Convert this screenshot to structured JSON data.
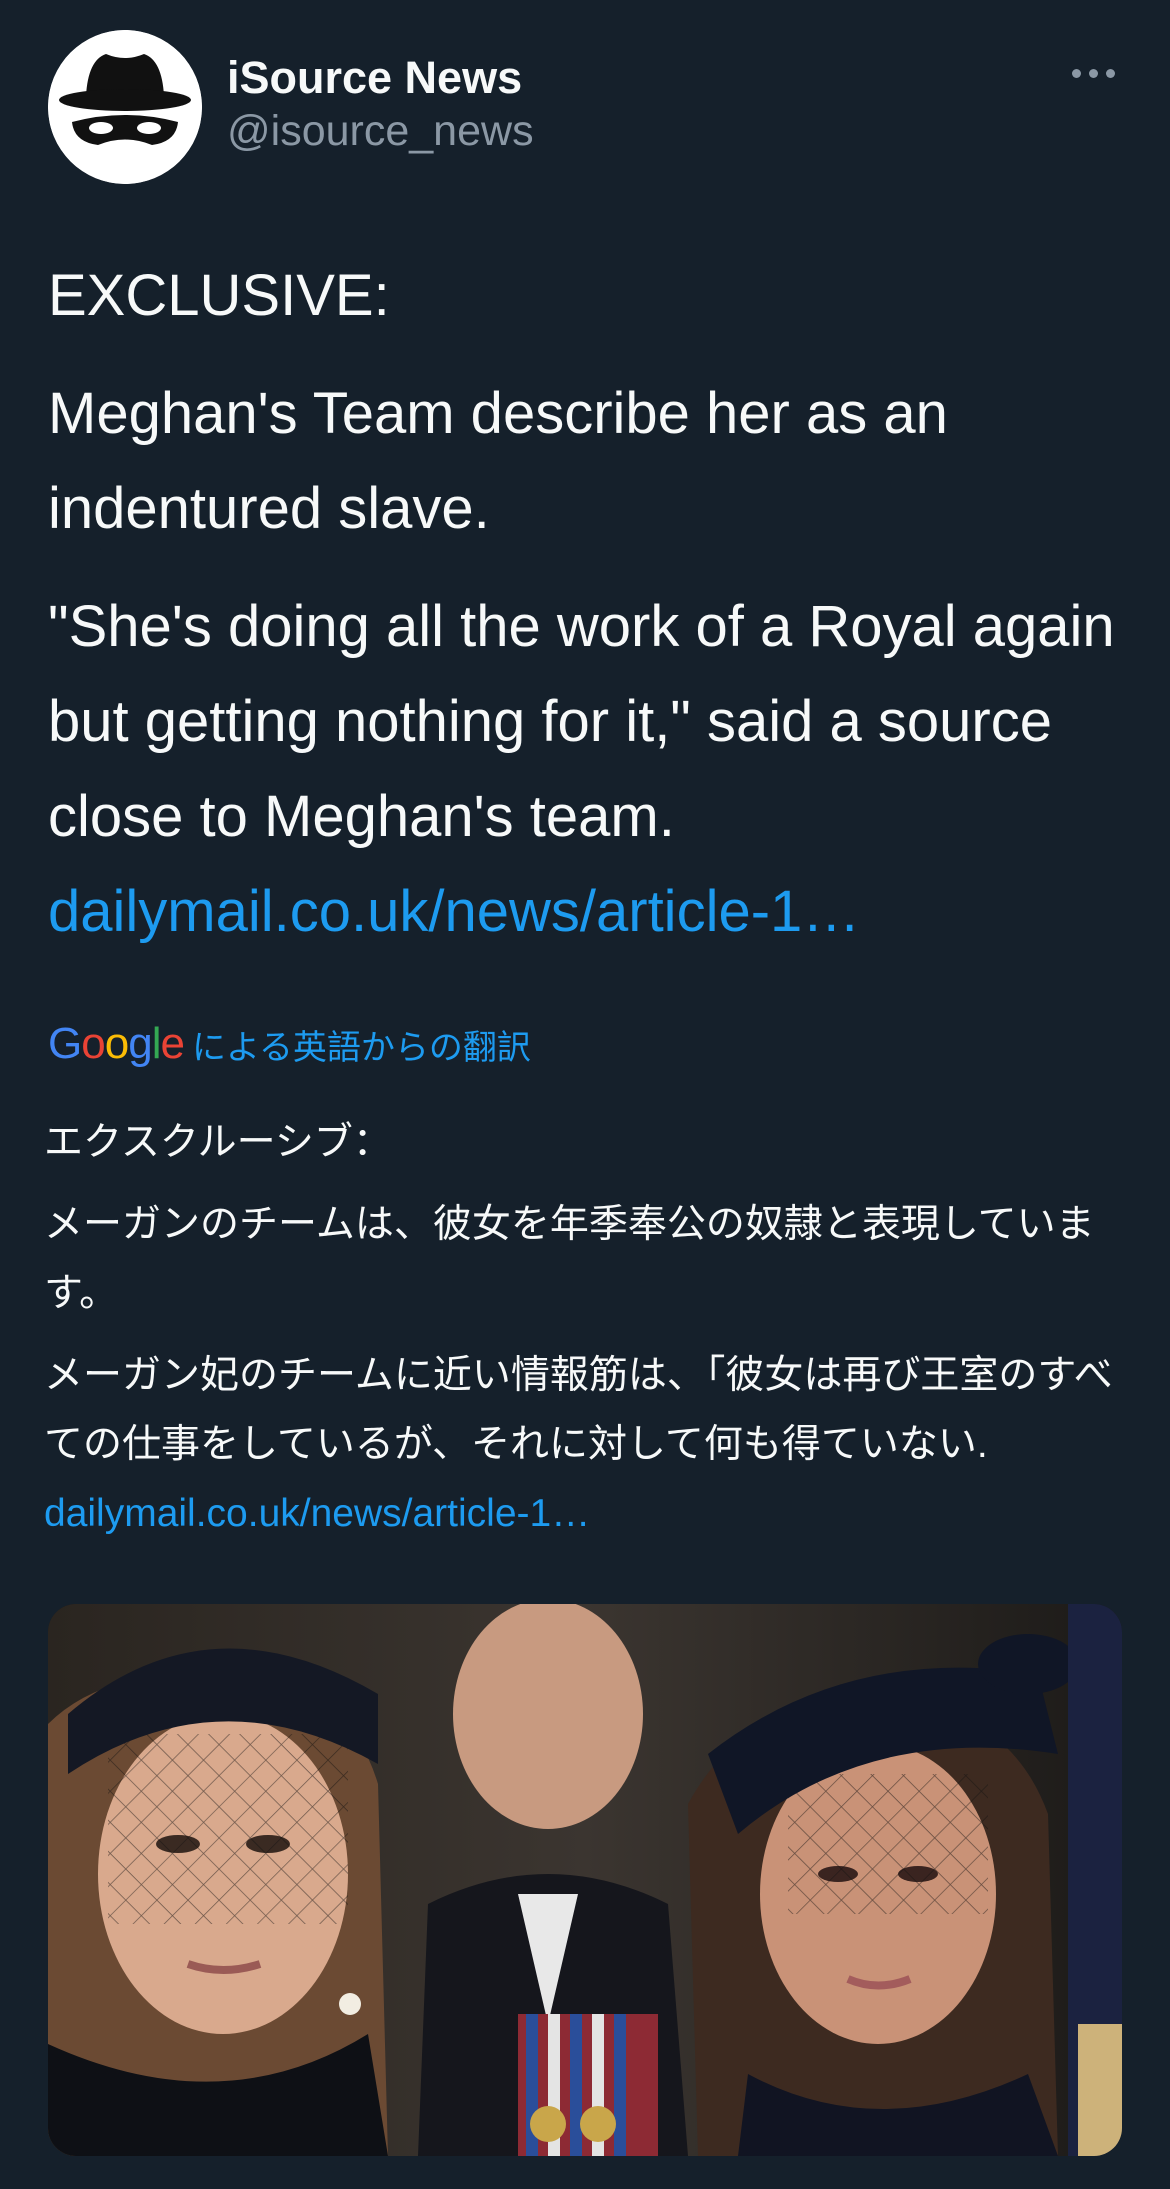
{
  "post": {
    "author": {
      "display_name": "iSource News",
      "handle": "@isource_news",
      "avatar_icon": "spy-hat-mask-icon"
    },
    "more_icon": "more-horizontal-icon",
    "body": {
      "paragraph_1": "EXCLUSIVE:",
      "paragraph_2": "Meghan's Team describe her as an indentured slave.",
      "paragraph_3": "\"She's doing all the work of a Royal again but getting nothing for it,\" said a source close to Meghan's team.",
      "link": "dailymail.co.uk/news/article-1…"
    },
    "translation": {
      "provider_logo": "Google",
      "label": "による英語からの翻訳",
      "paragraph_1": "エクスクルーシブ：",
      "paragraph_2": "メーガンのチームは、彼女を年季奉公の奴隷と表現しています。",
      "paragraph_3": "メーガン妃のチームに近い情報筋は、「彼女は再び王室のすべての仕事をしているが、それに対して何も得ていない.",
      "link": " dailymail.co.uk/news/article-1…"
    },
    "media": {
      "type": "photo"
    }
  },
  "colors": {
    "background": "#15202b",
    "text_primary": "#f7f9f9",
    "text_secondary": "#8b98a5",
    "link": "#1d9bf0",
    "google_blue": "#4285f4",
    "google_red": "#ea4335",
    "google_yellow": "#fbbc05",
    "google_green": "#34a853"
  }
}
